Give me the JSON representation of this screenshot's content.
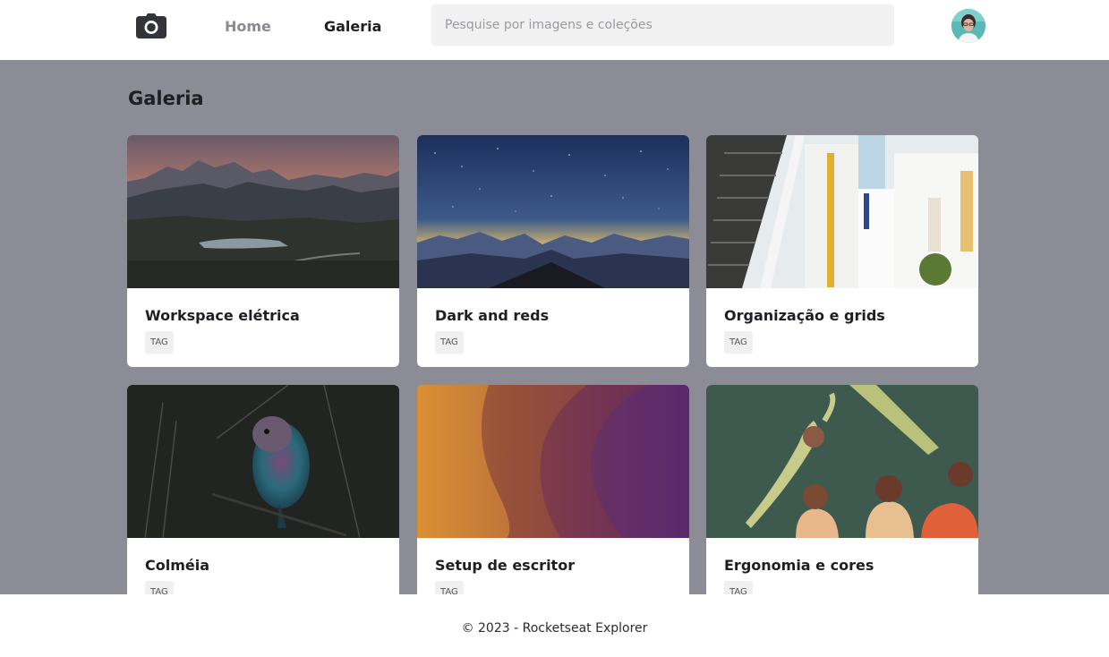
{
  "header": {
    "logo_icon": "camera-icon",
    "nav": [
      {
        "label": "Home",
        "active": false
      },
      {
        "label": "Galeria",
        "active": true
      }
    ],
    "search": {
      "value": "",
      "placeholder": "Pesquise por imagens e coleções"
    },
    "avatar_icon": "user-avatar"
  },
  "main": {
    "title": "Galeria",
    "cards": [
      {
        "title": "Workspace elétrica",
        "tag": "TAG",
        "image": "mountain-sunset"
      },
      {
        "title": "Dark and reds",
        "tag": "TAG",
        "image": "starry-night"
      },
      {
        "title": "Organização e grids",
        "tag": "TAG",
        "image": "white-stairs"
      },
      {
        "title": "Colméia",
        "tag": "TAG",
        "image": "bird"
      },
      {
        "title": "Setup de escritor",
        "tag": "TAG",
        "image": "abstract-waves"
      },
      {
        "title": "Ergonomia e cores",
        "tag": "TAG",
        "image": "swimmers-illustration"
      }
    ]
  },
  "footer": {
    "text": "© 2023 - Rocketseat Explorer"
  },
  "colors": {
    "main_bg": "#8c8c96",
    "text_dark": "#1e1e24",
    "nav_muted": "#8a8a93",
    "search_bg": "#f1f1f1"
  }
}
